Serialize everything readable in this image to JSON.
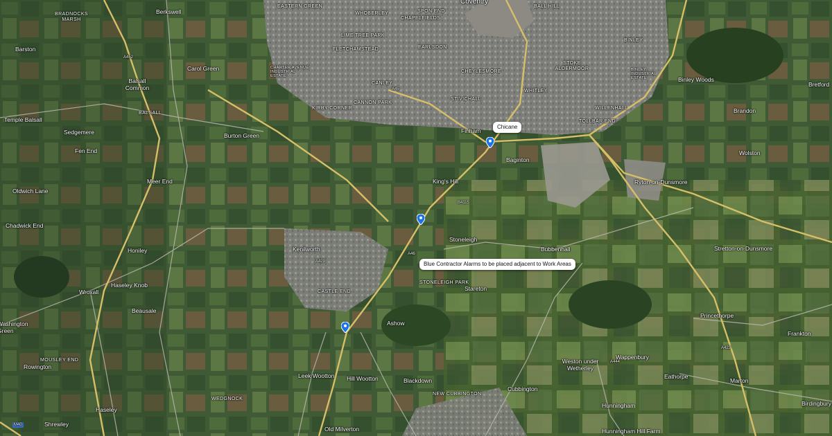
{
  "map": {
    "colors": {
      "field_dark": "#2f4a2a",
      "field_mid": "#4c6a3a",
      "field_light": "#6e8a4a",
      "field_brown": "#6a5a3c",
      "urban": "#8a8a86",
      "road_major": "#d8c06a",
      "road_minor": "#b8b8b0",
      "pin_blue": "#1e73e8"
    },
    "callouts": {
      "chicane": "Chicane",
      "alarms": "Blue Contractor Alarms to be placed adjacent to Work Areas"
    },
    "pins": [
      "marker-icon",
      "marker-icon",
      "marker-icon"
    ],
    "places": {
      "coventry": "Coventry",
      "spon_end": "SPON END",
      "lower_eastern_green": "EASTERN GREEN",
      "whoberley": "WHOBERLEY",
      "chapelfields": "CHAPELFIELDS",
      "ball_hill": "BALL HILL",
      "lime_tree_park": "LIME TREE PARK",
      "fletchamstead": "FLETCHAMSTEAD",
      "earlsdon": "EARLSDON",
      "cheylesmore": "CHEYLESMORE",
      "stoke_aldermoor": "STOKE ALDERMOOR",
      "binley": "BINLEY",
      "canley": "CANLEY",
      "cannon_park": "CANNON PARK",
      "kirby_corner": "KIRBY CORNER",
      "styvechale": "STIVICHALL",
      "whitley": "WHITLEY",
      "willenhall": "WILLENHALL",
      "tollbar_end": "TOLLBAR END",
      "binley_woods": "Binley Woods",
      "brandon": "Brandon",
      "bretford": "Bretford",
      "wolston": "Wolston",
      "finham": "Finham",
      "baginton": "Baginton",
      "kings_hill": "King's Hill",
      "ryton": "Ryton-on-Dunsmore",
      "stoneleigh": "Stoneleigh",
      "bubbenhall": "Bubbenhall",
      "stretton": "Stretton-on-Dunsmore",
      "stoneleigh_park": "STONELEIGH PARK",
      "stareton": "Stareton",
      "kenilworth": "Kenilworth",
      "castle_end": "CASTLE END",
      "ashow": "Ashow",
      "princethorpe": "Princethorpe",
      "frankton": "Frankton",
      "wappenbury": "Wappenbury",
      "weston": "Weston under Wetherley",
      "eathorpe": "Eathorpe",
      "marton": "Marton",
      "hunningham": "Hunningham",
      "hunningham_hill": "Hunningham Hill Farm",
      "birdingbury": "Birdingbury",
      "cubbington": "Cubbington",
      "new_cubbington": "NEW CUBBINGTON",
      "blackdown": "Blackdown",
      "hill_wootton": "Hill Wootton",
      "leek_wootton": "Leek Wootton",
      "old_milverton": "Old Milverton",
      "wedgnock": "WEDGNOCK",
      "haseley": "Haseley",
      "shrewley": "Shrewley",
      "rowington": "Rowington",
      "mousley_end": "MOUSLEY END",
      "beausale": "Beausale",
      "wroxall": "Wroxall",
      "haseley_knob": "Haseley Knob",
      "honiley": "Honiley",
      "chadwick_end": "Chadwick End",
      "oldwich_lane": "Oldwich Lane",
      "meer_end": "Meer End",
      "fen_end": "Fen End",
      "sedgemere": "Sedgemere",
      "temple_balsall": "Temple Balsall",
      "balsall": "BALSALL",
      "balsall_common": "Balsall Common",
      "berkswell": "Berkswell",
      "bradnocks_marsh": "BRADNOCKS MARSH",
      "barston": "Barston",
      "carol_green": "Carol Green",
      "burton_green": "Burton Green",
      "washington_green": "Washington Green",
      "canley_ind": "CHARTER AVENUE INDUSTRIAL ESTATE",
      "binley_ind": "BINLEY INDUSTRIAL ESTATE"
    },
    "roads": {
      "a45": "A45",
      "a46": "A46",
      "a452": "A452",
      "a429": "A429",
      "a423": "A423",
      "a444": "A444",
      "b4115": "B4115",
      "m40": "M40"
    }
  }
}
